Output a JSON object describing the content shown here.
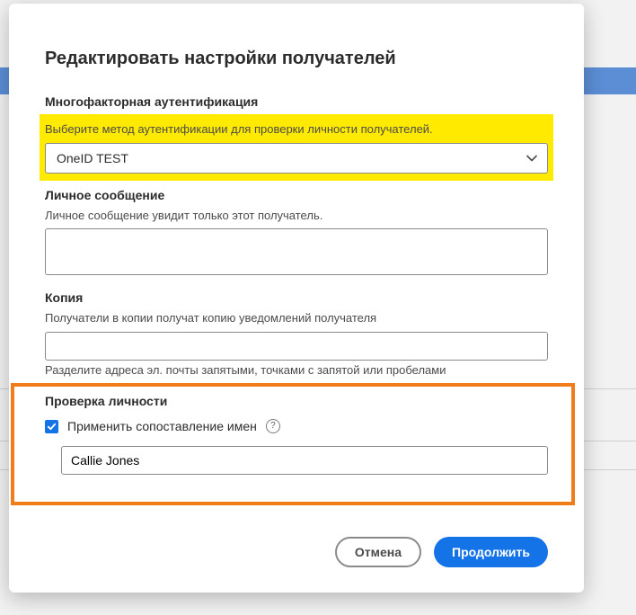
{
  "modal": {
    "title": "Редактировать настройки получателей"
  },
  "mfa": {
    "heading": "Многофакторная аутентификация",
    "help": "Выберите метод аутентификации для проверки личности получателей.",
    "selected": "OneID TEST"
  },
  "personal_message": {
    "heading": "Личное сообщение",
    "help": "Личное сообщение увидит только этот получатель.",
    "value": ""
  },
  "cc": {
    "heading": "Копия",
    "help": "Получатели в копии получат копию уведомлений получателя",
    "value": "",
    "note": "Разделите адреса эл. почты запятыми, точками с запятой или пробелами"
  },
  "identity": {
    "heading": "Проверка личности",
    "checkbox_label": "Применить сопоставление имен",
    "checked": true,
    "name_value": "Callie Jones"
  },
  "footer": {
    "cancel": "Отмена",
    "continue": "Продолжить"
  }
}
